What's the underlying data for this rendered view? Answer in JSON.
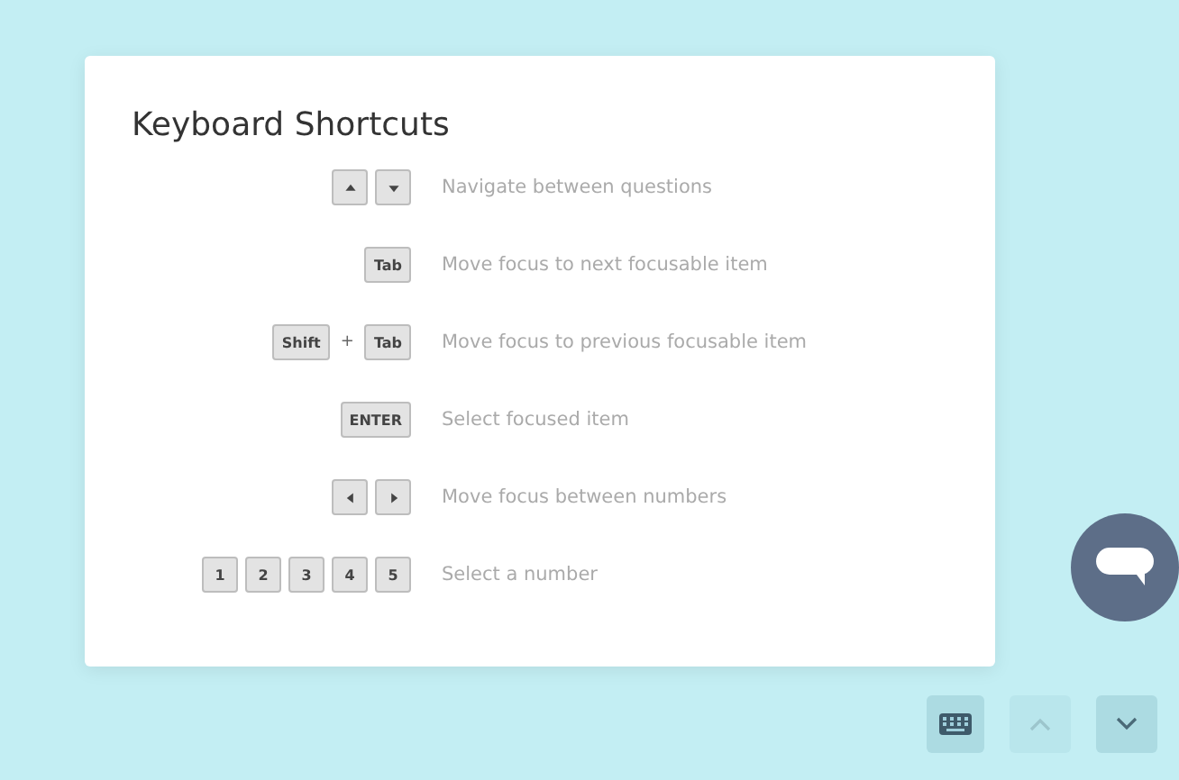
{
  "dialog": {
    "title": "Keyboard Shortcuts",
    "shortcuts": [
      {
        "keys": [
          {
            "kind": "up"
          },
          {
            "kind": "down"
          }
        ],
        "description": "Navigate between questions"
      },
      {
        "keys": [
          {
            "kind": "text",
            "label": "Tab"
          }
        ],
        "description": "Move focus to next focusable item"
      },
      {
        "keys": [
          {
            "kind": "text",
            "label": "Shift"
          },
          {
            "kind": "plus",
            "label": "+"
          },
          {
            "kind": "text",
            "label": "Tab"
          }
        ],
        "description": "Move focus to previous focusable item"
      },
      {
        "keys": [
          {
            "kind": "text",
            "label": "ENTER"
          }
        ],
        "description": "Select focused item"
      },
      {
        "keys": [
          {
            "kind": "left"
          },
          {
            "kind": "right"
          }
        ],
        "description": "Move focus between numbers"
      },
      {
        "keys": [
          {
            "kind": "text",
            "label": "1"
          },
          {
            "kind": "text",
            "label": "2"
          },
          {
            "kind": "text",
            "label": "3"
          },
          {
            "kind": "text",
            "label": "4"
          },
          {
            "kind": "text",
            "label": "5"
          }
        ],
        "description": "Select a number"
      }
    ]
  },
  "footer": {
    "buttons": [
      {
        "kind": "keyboard",
        "disabled": false
      },
      {
        "kind": "up",
        "disabled": true
      },
      {
        "kind": "down",
        "disabled": false
      }
    ]
  }
}
